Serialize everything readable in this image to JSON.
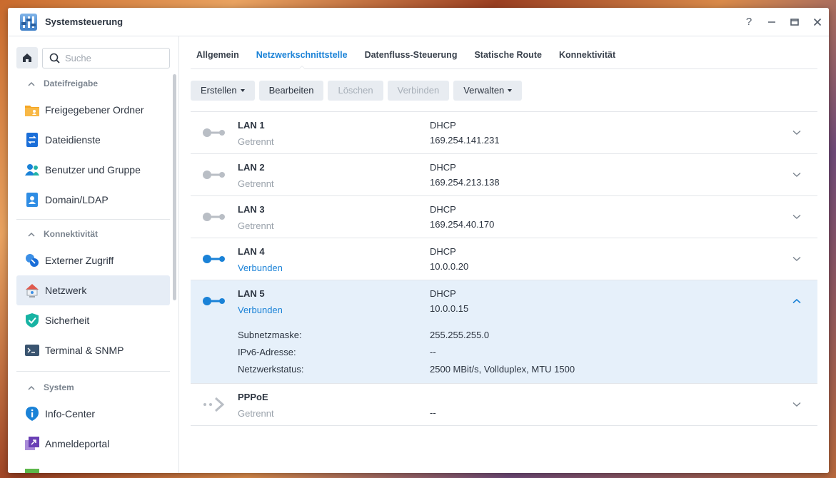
{
  "window": {
    "title": "Systemsteuerung"
  },
  "window_controls": {
    "help": "?",
    "minimize": "—",
    "maximize": "▭",
    "close": "✕"
  },
  "search": {
    "placeholder": "Suche"
  },
  "sidebar": {
    "groups": [
      {
        "header": "Dateifreigabe",
        "items": [
          {
            "label": "Freigegebener Ordner",
            "icon": "shared-folder-icon"
          },
          {
            "label": "Dateidienste",
            "icon": "file-services-icon"
          },
          {
            "label": "Benutzer und Gruppe",
            "icon": "users-icon"
          },
          {
            "label": "Domain/LDAP",
            "icon": "domain-icon"
          }
        ]
      },
      {
        "header": "Konnektivität",
        "items": [
          {
            "label": "Externer Zugriff",
            "icon": "external-access-icon"
          },
          {
            "label": "Netzwerk",
            "icon": "network-house-icon",
            "active": true
          },
          {
            "label": "Sicherheit",
            "icon": "security-shield-icon"
          },
          {
            "label": "Terminal & SNMP",
            "icon": "terminal-icon"
          }
        ]
      },
      {
        "header": "System",
        "items": [
          {
            "label": "Info-Center",
            "icon": "info-icon"
          },
          {
            "label": "Anmeldeportal",
            "icon": "login-portal-icon"
          }
        ]
      }
    ]
  },
  "tabs": [
    "Allgemein",
    "Netzwerkschnittstelle",
    "Datenfluss-Steuerung",
    "Statische Route",
    "Konnektivität"
  ],
  "active_tab": 1,
  "toolbar": {
    "create": "Erstellen",
    "edit": "Bearbeiten",
    "delete": "Löschen",
    "connect": "Verbinden",
    "manage": "Verwalten"
  },
  "interfaces": [
    {
      "name": "LAN 1",
      "status": "Getrennt",
      "mode": "DHCP",
      "ip": "169.254.141.231"
    },
    {
      "name": "LAN 2",
      "status": "Getrennt",
      "mode": "DHCP",
      "ip": "169.254.213.138"
    },
    {
      "name": "LAN 3",
      "status": "Getrennt",
      "mode": "DHCP",
      "ip": "169.254.40.170"
    },
    {
      "name": "LAN 4",
      "status": "Verbunden",
      "mode": "DHCP",
      "ip": "10.0.0.20"
    },
    {
      "name": "LAN 5",
      "status": "Verbunden",
      "mode": "DHCP",
      "ip": "10.0.0.15",
      "details": {
        "subnet_label": "Subnetzmaske:",
        "subnet": "255.255.255.0",
        "ipv6_label": "IPv6-Adresse:",
        "ipv6": "--",
        "netstatus_label": "Netzwerkstatus:",
        "netstatus": "2500 MBit/s, Vollduplex, MTU 1500"
      }
    },
    {
      "name": "PPPoE",
      "status": "Getrennt",
      "mode": "",
      "ip": "--"
    }
  ],
  "colors": {
    "accent": "#1a82d7",
    "disconnected": "#b9bec5",
    "selected_row": "#e6f0fa"
  }
}
